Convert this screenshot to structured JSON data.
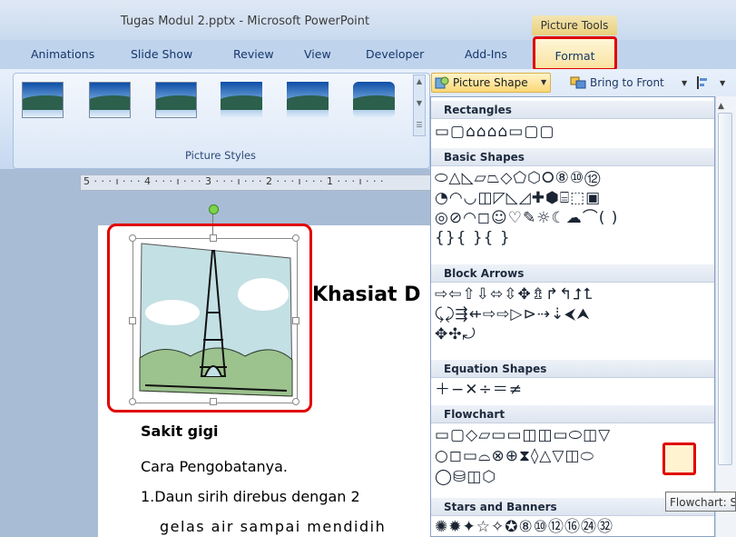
{
  "window": {
    "title": "Tugas Modul 2.pptx - Microsoft PowerPoint",
    "contextual_tab_group": "Picture Tools"
  },
  "tabs": [
    "Animations",
    "Slide Show",
    "Review",
    "View",
    "Developer",
    "Add-Ins",
    "Format"
  ],
  "ribbon": {
    "picture_styles_label": "Picture Styles",
    "picture_shape_label": "Picture Shape",
    "bring_to_front_label": "Bring to Front"
  },
  "ruler": {
    "text": "5 · · · ı · · · 4 · · · ı · · · 3 · · · ı · · · 2 · · · ı · · · 1 · · · ı · · ·"
  },
  "slide": {
    "heading": "Khasiat D",
    "subheading": "Sakit gigi",
    "line1": "Cara Pengobatanya.",
    "line2": "1.Daun sirih direbus dengan 2",
    "line3": "gelas air sampai mendidih"
  },
  "shape_panel": {
    "sections": [
      {
        "name": "Rectangles",
        "rows": [
          "▭▢⌂⌂⌂⌂▭▢▢"
        ]
      },
      {
        "name": "Basic Shapes",
        "rows": [
          "⬭△◺▱⏢◇⬠⬡⭘⑧⑩⑫",
          "◔◠◡◫◸◺◿✚⬢⌸⬚▣",
          "◎⊘◠◻☺♡✎☼☾☁⌒( )",
          "{}{ }{ }"
        ]
      },
      {
        "name": "Block Arrows",
        "rows": [
          "⇨⇦⇧⇩⬄⇳✥⇯↱↰⮥⮤",
          "⤹⤸⇶⇷⇨⇨▷⊳⇢⇣⮜⮝",
          "✥✣⤾"
        ]
      },
      {
        "name": "Equation Shapes",
        "rows": [
          "＋−✕÷＝≠"
        ]
      },
      {
        "name": "Flowchart",
        "rows": [
          "▭▢◇▱▭▭◫◫▭⬭◫▽",
          "○◻▭⌓⊗⊕⧗◊△▽◫⬭",
          "◯⛁◫⬡"
        ]
      },
      {
        "name": "Stars and Banners",
        "rows": [
          "✺✹✦☆✧✪⑧⑩⑫⑯㉔㉜"
        ]
      }
    ]
  },
  "tooltip": "Flowchart: Stored Data"
}
